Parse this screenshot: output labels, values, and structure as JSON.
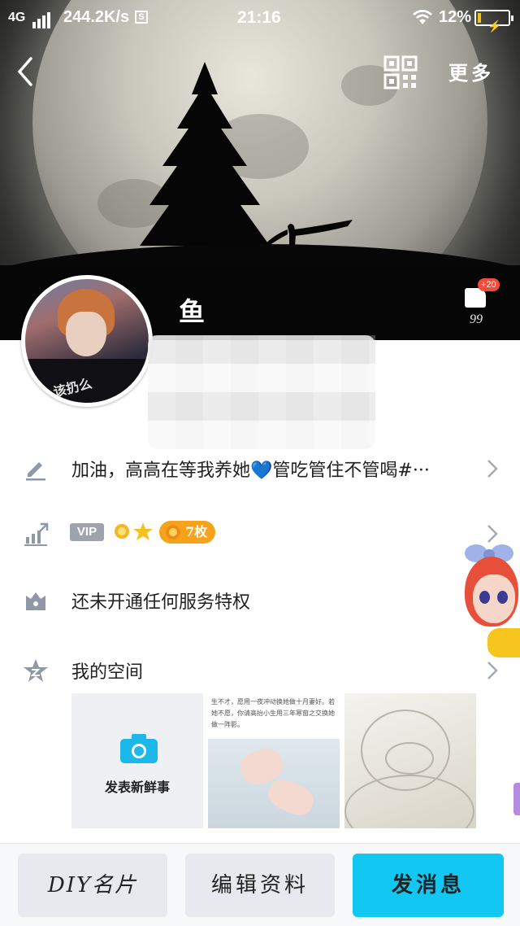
{
  "status_bar": {
    "network": "4G",
    "speed": "244.2K/s",
    "s_badge": "S",
    "time": "21:16",
    "battery_percent": "12%",
    "battery_level": 0.12
  },
  "header": {
    "more_label": "更多"
  },
  "profile": {
    "nickname": "鱼",
    "avatar_caption": "该扔么",
    "likes_badge": "+20",
    "likes_count": "99"
  },
  "rows": {
    "signature": "加油，高高在等我养她💙管吃管住不管喝#···",
    "vip": {
      "vip_label": "VIP",
      "coin_label": "7枚"
    },
    "service": "还未开通任何服务特权",
    "space": "我的空间"
  },
  "photos": {
    "add_label": "发表新鲜事",
    "photo1_caption": "生不才，愿用一夜冲动换她做十月妻好。若她不愿，你请高抬小生用三年寒窗之交换她做一阵影。"
  },
  "bottom_bar": {
    "diy_label": "DIY名片",
    "edit_label": "编辑资料",
    "message_label": "发消息"
  },
  "colors": {
    "accent": "#12c7f2",
    "coin_orange": "#f7a21b",
    "vip_gray": "#9ea3ad",
    "heart_blue": "#2e7fe6",
    "badge_red": "#f24b3c"
  },
  "icons": {
    "back": "chevron-left-icon",
    "qr": "qr-code-icon",
    "like": "thumbs-up-icon",
    "signature": "pencil-icon",
    "vip": "rank-up-icon",
    "service": "crown-box-icon",
    "space": "star-icon",
    "camera": "camera-icon",
    "chevron": "chevron-right-icon"
  }
}
